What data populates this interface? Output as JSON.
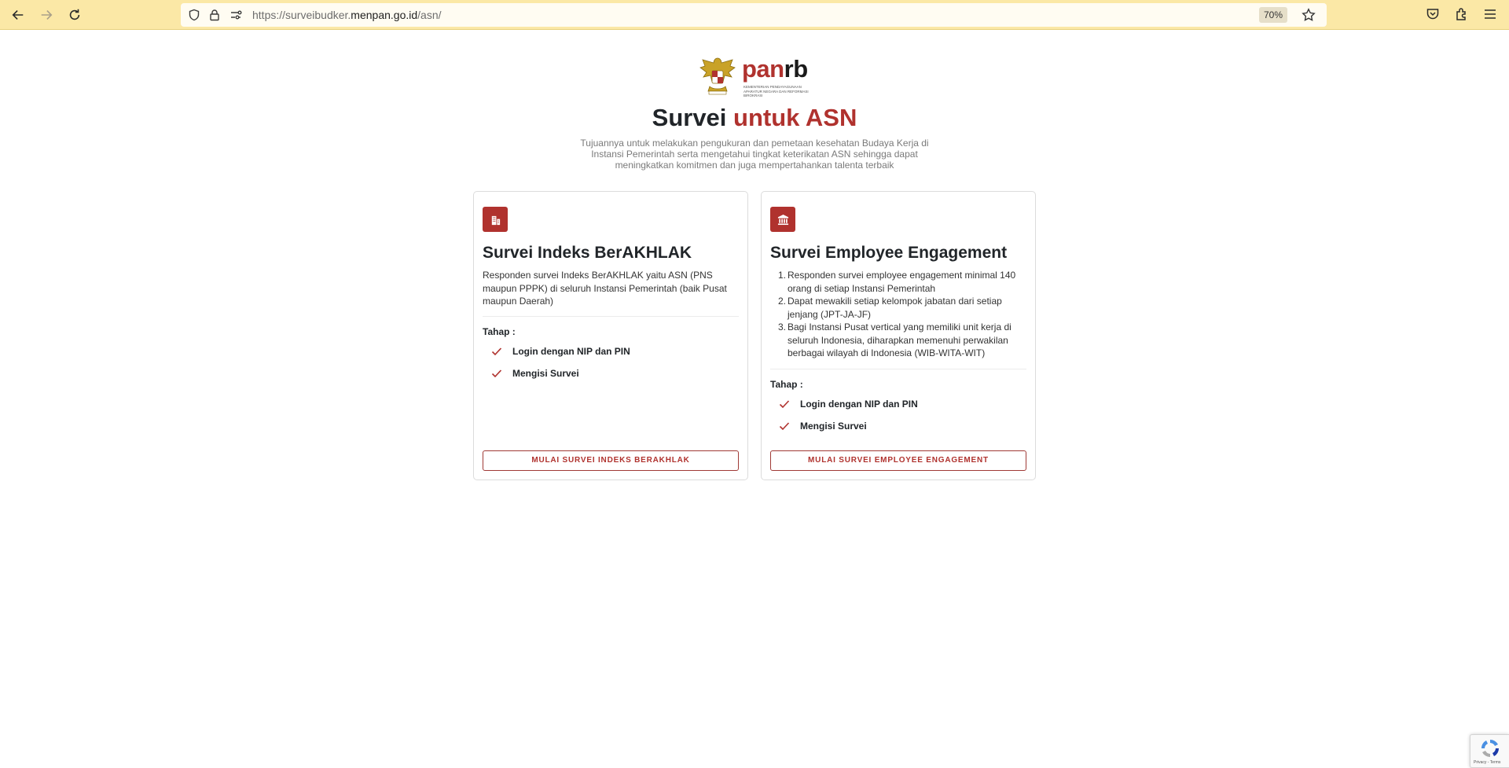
{
  "browser": {
    "url_prefix": "https://surveibudker.",
    "url_domain": "menpan.go.id",
    "url_path": "/asn/",
    "zoom": "70%"
  },
  "logo": {
    "word_pan": "pan",
    "word_rb": "rb",
    "subtitle": "Kementerian Pendayagunaan Aparatur Negara dan Reformasi Birokrasi"
  },
  "header": {
    "title_part1": "Survei",
    "title_part2": "untuk ASN",
    "description": "Tujuannya untuk melakukan pengukuran dan pemetaan kesehatan Budaya Kerja di Instansi Pemerintah serta mengetahui tingkat keterikatan ASN sehingga dapat meningkatkan komitmen dan juga mempertahankan talenta terbaik"
  },
  "cards": [
    {
      "title": "Survei Indeks BerAKHLAK",
      "text": "Responden survei Indeks BerAKHLAK yaitu ASN (PNS maupun PPPK) di seluruh Instansi Pemerintah (baik Pusat maupun Daerah)",
      "tahap_label": "Tahap :",
      "steps": [
        "Login dengan NIP dan PIN",
        "Mengisi Survei"
      ],
      "button_label": "MULAI SURVEI INDEKS BERAKHLAK"
    },
    {
      "title": "Survei Employee Engagement",
      "items": [
        "Responden survei employee engagement minimal 140 orang di setiap Instansi Pemerintah",
        "Dapat mewakili setiap kelompok jabatan dari setiap jenjang (JPT-JA-JF)",
        "Bagi Instansi Pusat vertical yang memiliki unit kerja di seluruh Indonesia, diharapkan memenuhi perwakilan berbagai wilayah di Indonesia (WIB-WITA-WIT)"
      ],
      "item_numbers": [
        "1.",
        "2.",
        "3."
      ],
      "tahap_label": "Tahap :",
      "steps": [
        "Login dengan NIP dan PIN",
        "Mengisi Survei"
      ],
      "button_label": "MULAI SURVEI EMPLOYEE ENGAGEMENT"
    }
  ],
  "recaptcha": {
    "text": "Privacy - Terms"
  },
  "colors": {
    "accent": "#b0322e",
    "toolbar": "#fbe8a6"
  },
  "icons": {
    "back": "arrow-left-icon",
    "forward": "arrow-right-icon",
    "reload": "reload-icon",
    "card_left": "building-icon",
    "card_right": "institution-icon",
    "check": "check-icon"
  }
}
